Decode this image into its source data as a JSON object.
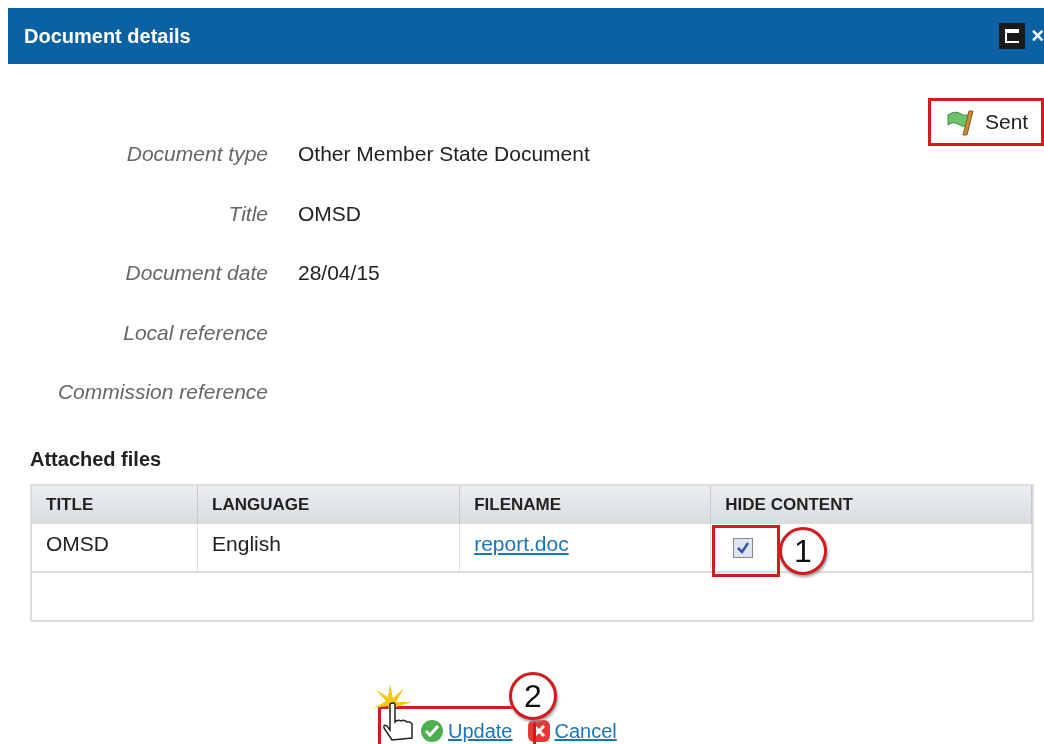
{
  "dialog": {
    "title": "Document details",
    "close": "×",
    "status": {
      "label": "Sent"
    },
    "fields": [
      {
        "label": "Document type",
        "value": "Other Member State Document"
      },
      {
        "label": "Title",
        "value": "OMSD"
      },
      {
        "label": "Document date",
        "value": "28/04/15"
      },
      {
        "label": "Local reference"
      },
      {
        "label": "Commission reference"
      }
    ],
    "attachments": {
      "heading": "Attached files",
      "columns": [
        "TITLE",
        "LANGUAGE",
        "FILENAME",
        "HIDE CONTENT"
      ],
      "rows": [
        {
          "title": "OMSD",
          "language": "English",
          "filename": "report.doc",
          "hide_content": true
        }
      ]
    },
    "buttons": [
      {
        "kind": "update",
        "label": "Update"
      },
      {
        "kind": "cancel",
        "label": "Cancel"
      }
    ]
  },
  "callouts": [
    "1",
    "2"
  ]
}
